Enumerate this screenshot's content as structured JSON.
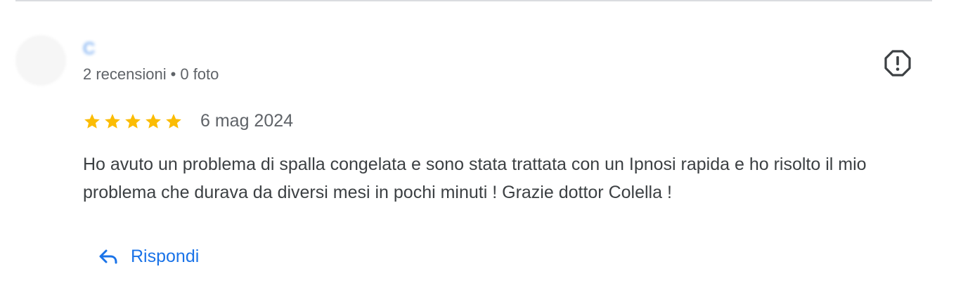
{
  "reviewer": {
    "name": "C",
    "reviews_count": "2 recensioni",
    "separator": "•",
    "photos_count": "0 foto"
  },
  "review": {
    "rating": 5,
    "date": "6 mag 2024",
    "text": "Ho avuto un problema di spalla congelata e sono stata trattata con un Ipnosi rapida e ho risolto il mio problema che durava da diversi mesi in pochi minuti ! Grazie dottor Colella !"
  },
  "actions": {
    "reply_label": "Rispondi",
    "reply_icon": "reply-arrow-icon",
    "report_icon": "report-icon"
  },
  "colors": {
    "star": "#fbbc04",
    "link": "#1a73e8",
    "text": "#3c4043",
    "secondary_text": "#5f6368",
    "divider": "#dadce0"
  }
}
